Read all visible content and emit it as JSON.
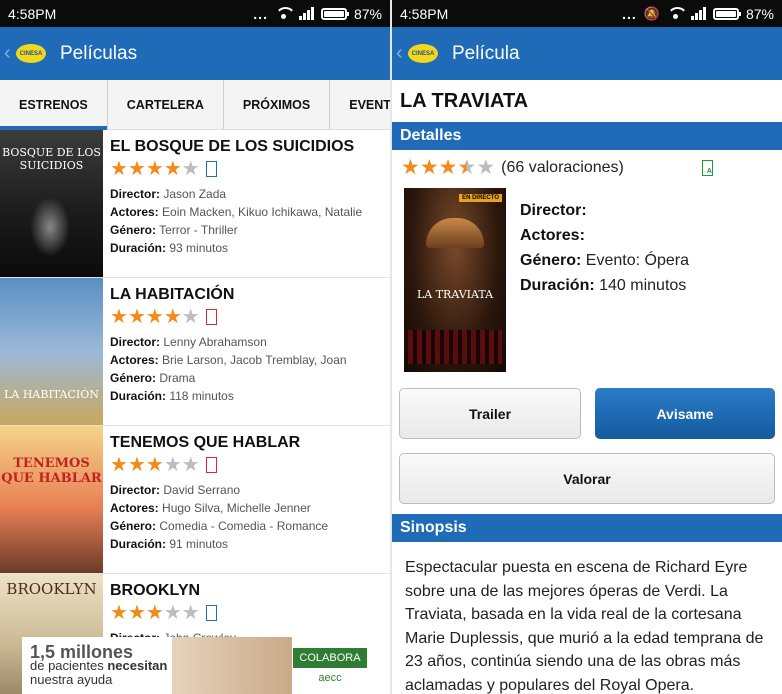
{
  "status_left": {
    "time": "4:58PM",
    "dots": "...",
    "battery": "87%"
  },
  "status_right": {
    "time": "4:58PM",
    "dots": "...",
    "battery": "87%"
  },
  "left": {
    "appbar_title": "Películas",
    "logo_text": "CINESA",
    "tabs": [
      "ESTRENOS",
      "CARTELERA",
      "PRÓXIMOS",
      "EVENTOS"
    ],
    "labels": {
      "director": "Director:",
      "actores": "Actores:",
      "genero": "Género:",
      "duracion": "Duración:"
    },
    "movies": [
      {
        "title": "EL BOSQUE DE LOS SUICIDIOS",
        "poster_text": "BOSQUE DE LOS SUICIDIOS",
        "stars": 4,
        "rating_color": "blue",
        "director": " Jason Zada",
        "actores": " Eoin Macken, Kikuo Ichikawa, Natalie",
        "genero": " Terror - Thriller",
        "duracion": " 93 minutos"
      },
      {
        "title": "LA HABITACIÓN",
        "poster_text": "LA HABITACIÓN",
        "stars": 4,
        "rating_color": "red",
        "director": " Lenny Abrahamson",
        "actores": " Brie Larson, Jacob Tremblay, Joan",
        "genero": " Drama",
        "duracion": " 118 minutos"
      },
      {
        "title": "TENEMOS QUE HABLAR",
        "poster_text": "TENEMOS QUE HABLAR",
        "stars": 3,
        "rating_color": "red",
        "director": " David Serrano",
        "actores": " Hugo Silva, Michelle Jenner",
        "genero": " Comedia - Comedia - Romance",
        "duracion": " 91 minutos"
      },
      {
        "title": "BROOKLYN",
        "poster_text": "BROOKLYN",
        "stars": 3,
        "rating_color": "blue",
        "director": " John Crowley",
        "actores": "",
        "genero": "",
        "duracion": ""
      }
    ],
    "ad": {
      "line1": "1,5 millones",
      "line2": "de pacientes",
      "line2b": "necesitan",
      "line3": "nuestra ayuda",
      "button": "COLABORA",
      "logo": "aecc"
    }
  },
  "right": {
    "appbar_title": "Película",
    "logo_text": "CINESA",
    "title": "LA TRAVIATA",
    "detalles_header": "Detalles",
    "rating_value": 3.5,
    "valoraciones": "(66 valoraciones)",
    "poster_badge": "EN DIRECTO",
    "poster_text": "LA TRAVIATA",
    "director_label": "Director:",
    "director_value": "",
    "actores_label": "Actores:",
    "actores_value": "",
    "genero_label": "Género:",
    "genero_value": " Evento: Ópera",
    "duracion_label": "Duración:",
    "duracion_value": " 140 minutos",
    "trailer_button": "Trailer",
    "avisame_button": "Avisame",
    "valorar_button": "Valorar",
    "sinopsis_header": "Sinopsis",
    "sinopsis_text": "Espectacular puesta en escena de Richard Eyre sobre una de las mejores óperas de Verdi. La Traviata, basada en la vida real de la cortesana Marie Duplessis, que murió a la edad temprana de 23 años, continúa siendo una de las obras más aclamadas y populares del Royal Opera."
  },
  "colors": {
    "brand": "#1f6bb8",
    "star": "#f28b1a",
    "star_off": "#bdbdbd"
  }
}
